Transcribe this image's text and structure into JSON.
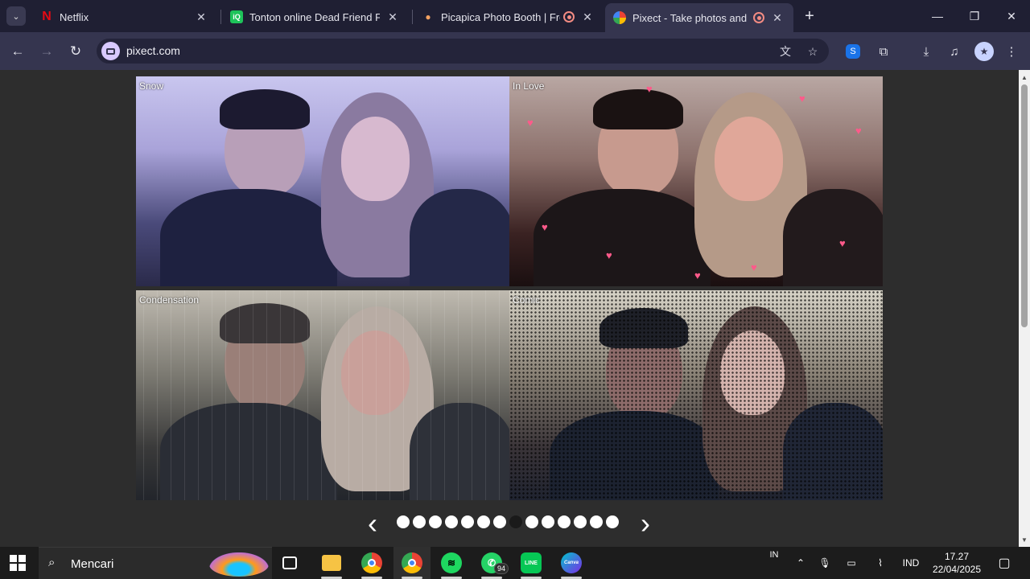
{
  "browser": {
    "tabs": [
      {
        "title": "Netflix",
        "favicon": "netflix-icon",
        "color": "#e50914",
        "recording": false,
        "active": false
      },
      {
        "title": "Tonton online Dead Friend Fore",
        "favicon": "iqiyi-icon",
        "color": "#1ec35a",
        "recording": false,
        "active": false
      },
      {
        "title": "Picapica Photo Booth | Free",
        "favicon": "picapica-icon",
        "color": "#f4a261",
        "recording": true,
        "active": false
      },
      {
        "title": "Pixect - Take photos and m",
        "favicon": "pixect-icon",
        "color": "#4caf50",
        "recording": true,
        "active": true
      }
    ],
    "url": "pixect.com"
  },
  "gallery": {
    "photos": [
      {
        "label": "Snow",
        "filter": "snow"
      },
      {
        "label": "In Love",
        "filter": "inlove"
      },
      {
        "label": "Condensation",
        "filter": "condensation"
      },
      {
        "label": "Comic",
        "filter": "comic"
      }
    ],
    "page_count": 14,
    "active_page": 8
  },
  "taskbar": {
    "search_placeholder": "Mencari",
    "apps": [
      {
        "name": "task-view",
        "icon": "task-view-icon"
      },
      {
        "name": "file-explorer",
        "icon": "folder-icon",
        "color": "#f6c344"
      },
      {
        "name": "chrome",
        "icon": "chrome-icon",
        "color": "#4285f4"
      },
      {
        "name": "chrome-profile",
        "icon": "chrome-icon",
        "color": "#4285f4"
      },
      {
        "name": "spotify",
        "icon": "spotify-icon",
        "color": "#1ed760"
      },
      {
        "name": "whatsapp",
        "icon": "whatsapp-icon",
        "color": "#25d366",
        "badge": "94"
      },
      {
        "name": "line",
        "icon": "line-icon",
        "color": "#06c755",
        "glyph": "LINE"
      },
      {
        "name": "canva",
        "icon": "canva-icon",
        "color": "#7d2ae8",
        "glyph": "Canva"
      }
    ],
    "tray": {
      "ime": "IN",
      "language": "IND",
      "time": "17.27",
      "date": "22/04/2025"
    }
  }
}
